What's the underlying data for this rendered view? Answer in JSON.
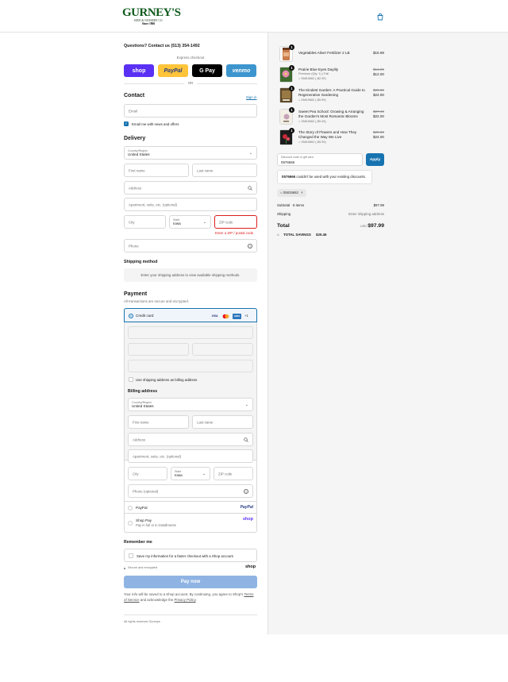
{
  "header": {
    "logo_text": "GURNEY'S",
    "logo_sub": "SEED & NURSERY CO.",
    "logo_since": "Since 1866"
  },
  "contact_line": "Questions? Contact us (513) 354-1492",
  "express": {
    "label": "Express checkout",
    "buttons": [
      {
        "label": "shop",
        "color": "#5a31f4"
      },
      {
        "label": "PayPal",
        "color": "#ffc439"
      },
      {
        "label": "G Pay",
        "color": "#000000"
      },
      {
        "label": "venmo",
        "color": "#3d95ce"
      }
    ],
    "or_label": "OR"
  },
  "contact": {
    "title": "Contact",
    "signin": "Sign in",
    "email_placeholder": "Email",
    "news_label": "Email me with news and offers"
  },
  "delivery": {
    "title": "Delivery",
    "country_label": "Country/Region",
    "country_value": "United States",
    "first_name": "First name",
    "last_name": "Last name",
    "address": "Address",
    "apartment": "Apartment, suite, etc. (optional)",
    "city": "City",
    "state_label": "State",
    "state_value": "Iowa",
    "zip": "ZIP code",
    "zip_error": "Enter a ZIP / postal code",
    "phone": "Phone"
  },
  "shipping": {
    "title": "Shipping method",
    "notice": "Enter your shipping address to view available shipping methods."
  },
  "payment": {
    "title": "Payment",
    "subtitle": "All transactions are secure and encrypted.",
    "credit_card": "Credit card",
    "card_badges": [
      "VISA",
      "MC",
      "AMEX",
      "+1"
    ],
    "use_shipping": "Use shipping address as billing address",
    "billing_title": "Billing address",
    "billing": {
      "country_label": "Country/Region",
      "country_value": "United States",
      "first_name": "First name",
      "last_name": "Last name",
      "address": "Address",
      "apartment": "Apartment, suite, etc. (optional)",
      "city": "City",
      "state_label": "State",
      "state_value": "Iowa",
      "zip": "ZIP code",
      "phone": "Phone (optional)"
    },
    "paypal": "PayPal",
    "paypal_logo": "PayPal",
    "shoppay": "Shop Pay",
    "shoppay_sub": "Pay in full or in installments",
    "shoppay_logo": "shop"
  },
  "remember": {
    "title": "Remember me",
    "save_label": "Save my information for a faster checkout with a Shop account",
    "secure": "Secure and encrypted",
    "shop_logo": "shop"
  },
  "paynow": "Pay now",
  "legal": {
    "text1": "Your info will be saved to a Shop account. By continuing, you agree to Shop's",
    "terms": "Terms of Service",
    "text2": "and acknowledge the",
    "privacy": "Privacy Policy",
    "period": "."
  },
  "footer": "All rights reserved Gurneys",
  "cart": {
    "items": [
      {
        "qty": "1",
        "name": "Vegetables Alive! Fertilizer 2 LB",
        "sub": "",
        "old": "",
        "price": "$15.99",
        "tag": ""
      },
      {
        "qty": "1",
        "name": "Prairie Blue Eyes Daylily",
        "sub": "Premium (Qty: 1) | Fall",
        "old": "$14.99",
        "price": "$12.00",
        "tag": "05819662 (-$2.99)"
      },
      {
        "qty": "1",
        "name": "The Kindest Garden: A Practical Guide to Regenerative Gardening",
        "sub": "",
        "old": "$29.99",
        "price": "$24.00",
        "tag": "05819662 (-$5.99)"
      },
      {
        "qty": "1",
        "name": "Sweet Pea School: Growing & Arranging the Garden's Most Romantic Blooms",
        "sub": "",
        "old": "$27.49",
        "price": "$22.00",
        "tag": "05819662 (-$5.49)"
      },
      {
        "qty": "1",
        "name": "The Story of Flowers and How They Changed the Way We Live",
        "sub": "",
        "old": "$29.99",
        "price": "$24.00",
        "tag": "05819662 (-$5.99)"
      }
    ],
    "discount_label": "Discount code or gift card",
    "discount_value": "0576666",
    "apply": "Apply",
    "discount_error_code": "0576666",
    "discount_error_text": "couldn't be used with your existing discounts.",
    "applied_code": "05819662",
    "subtotal_label": "Subtotal · 5 items",
    "subtotal_value": "$97.99",
    "shipping_label": "Shipping",
    "shipping_value": "Enter shipping address",
    "total_label": "Total",
    "currency": "USD",
    "total_value": "$97.99",
    "savings_label": "TOTAL SAVINGS",
    "savings_value": "$20.46"
  }
}
